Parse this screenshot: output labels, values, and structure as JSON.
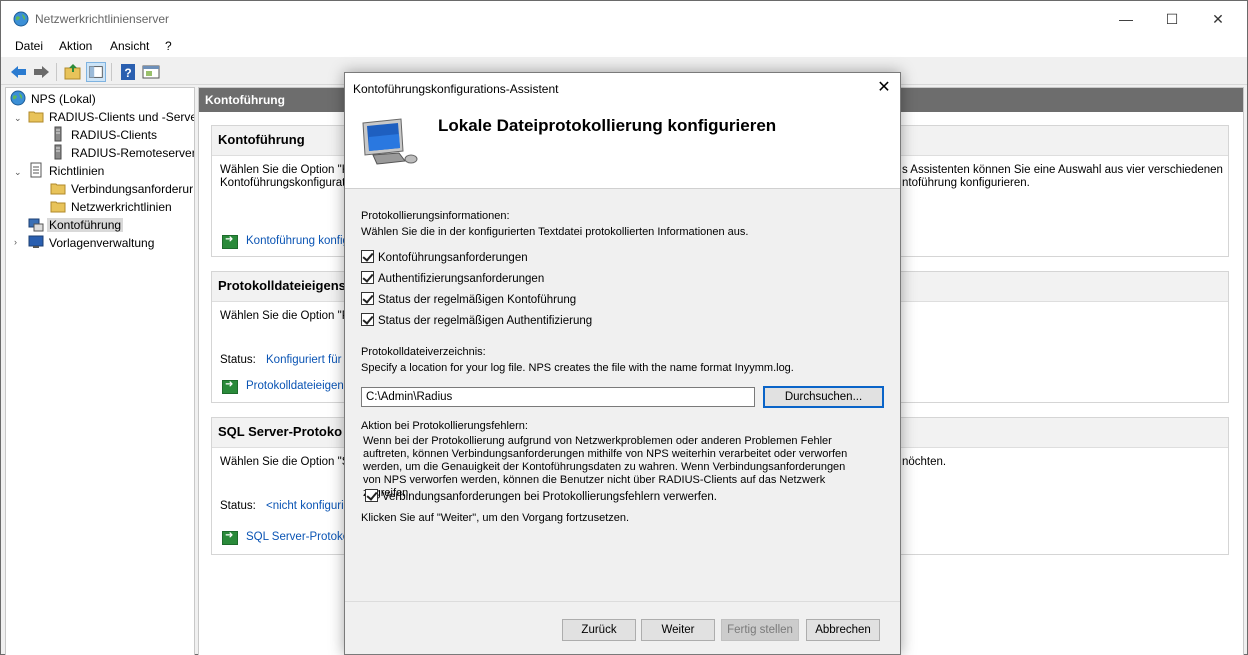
{
  "window": {
    "title": "Netzwerkrichtlinienserver",
    "controls": {
      "minimize": "—",
      "maximize": "☐",
      "close": "✕"
    }
  },
  "menu": [
    "Datei",
    "Aktion",
    "Ansicht",
    "?"
  ],
  "toolbar": {
    "buttons": [
      "back-arrow-icon",
      "forward-arrow-icon",
      "up-folder-icon",
      "show-hide-tree-icon",
      "help-icon",
      "properties-icon"
    ]
  },
  "tree": {
    "root": "NPS (Lokal)",
    "radius_group": "RADIUS-Clients und -Serve",
    "radius_clients": "RADIUS-Clients",
    "radius_remote": "RADIUS-Remoteserverg",
    "policies": "Richtlinien",
    "connection_requests": "Verbindungsanforderur",
    "network_policies": "Netzwerkrichtlinien",
    "accounting": "Kontoführung",
    "templates": "Vorlagenverwaltung"
  },
  "content": {
    "header": "Kontoführung",
    "sections": [
      {
        "title": "Kontoführung",
        "text": "Wählen Sie die Option \"Kon",
        "text2": "Kontoführungskonfiguratio",
        "text_right": "s Assistenten können Sie eine Auswahl aus vier verschiedenen",
        "text_right2": "ntoführung konfigurieren.",
        "link": "Kontoführung konfigu"
      },
      {
        "title": "Protokolldateieigens",
        "text": "Wählen Sie die Option \"Pro",
        "status_label": "Status:",
        "status_value": "Konfiguriert für C",
        "link": "Protokolldateieigensc"
      },
      {
        "title": "SQL Server-Protoko",
        "text": "Wählen Sie die Option \"SQ",
        "text_right": "nöchten.",
        "status_label": "Status:",
        "status_value": "<nicht konfigurier",
        "link": "SQL Server-Protokoll"
      }
    ]
  },
  "dialog": {
    "title": "Kontoführungskonfigurations-Assistent",
    "close": "✕",
    "heading": "Lokale Dateiprotokollierung konfigurieren",
    "logging_info_label": "Protokollierungsinformationen:",
    "logging_info_desc": "Wählen Sie die in der konfigurierten Textdatei protokollierten Informationen aus.",
    "checkboxes": [
      {
        "label": "Kontoführungsanforderungen",
        "checked": true
      },
      {
        "label": "Authentifizierungsanforderungen",
        "checked": true
      },
      {
        "label": "Status der regelmäßigen Kontoführung",
        "checked": true
      },
      {
        "label": "Status der regelmäßigen Authentifizierung",
        "checked": true
      }
    ],
    "log_dir_label": "Protokolldateiverzeichnis:",
    "log_dir_desc": "Specify a location for your log file. NPS creates the file with the name format Inyymm.log.",
    "log_dir_value": "C:\\Admin\\Radius",
    "browse_label": "Durchsuchen...",
    "error_label": "Aktion bei Protokollierungsfehlern:",
    "error_text": "Wenn bei der Protokollierung aufgrund von Netzwerkproblemen oder anderen Problemen Fehler auftreten, können Verbindungsanforderungen mithilfe von NPS weiterhin verarbeitet oder verworfen werden, um die Genauigkeit der Kontoführungsdaten zu wahren. Wenn Verbindungsanforderungen von NPS verworfen werden, können die Benutzer nicht über RADIUS-Clients auf das Netzwerk zugreifen.",
    "discard_checkbox": {
      "label": "Verbindungsanforderungen bei Protokollierungsfehlern verwerfen.",
      "checked": true
    },
    "continue_hint": "Klicken Sie auf \"Weiter\", um den Vorgang fortzusetzen.",
    "buttons": {
      "back": "Zurück",
      "next": "Weiter",
      "finish": "Fertig stellen",
      "cancel": "Abbrechen"
    }
  }
}
